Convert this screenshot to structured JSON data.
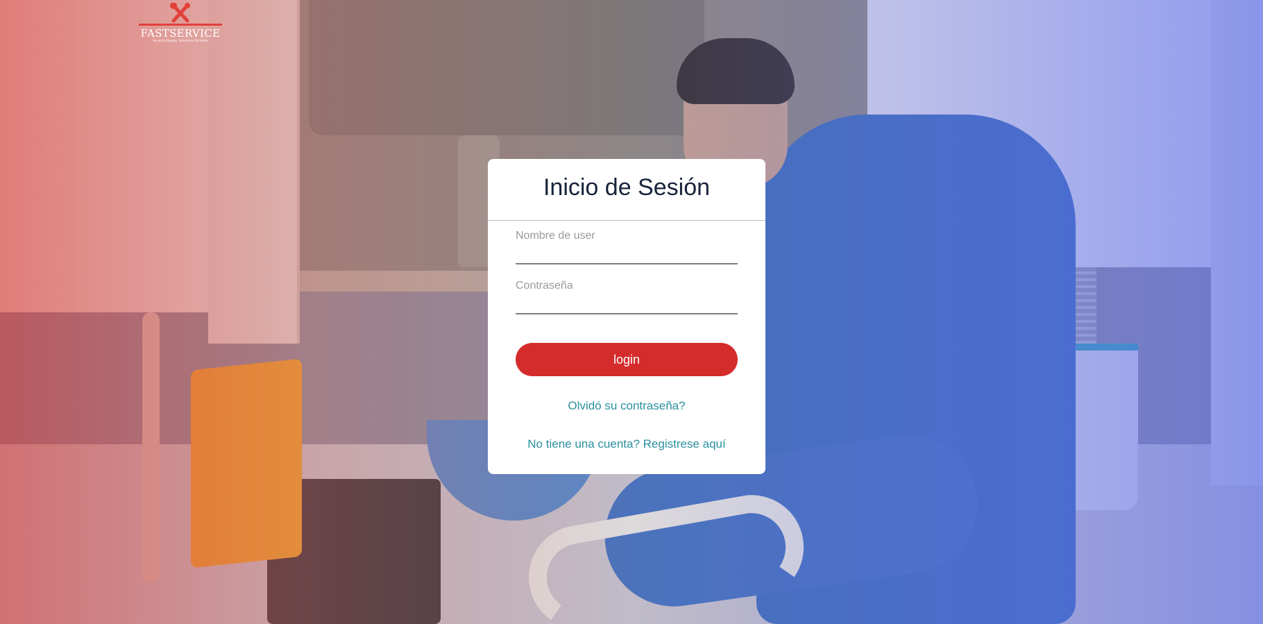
{
  "logo": {
    "name": "FASTSERVICE",
    "tagline": "Servicios Rápidos, Soluciones Eficientes",
    "icon": "wrench-screwdriver-icon",
    "color": "#e2403a"
  },
  "login": {
    "title": "Inicio de Sesión",
    "username_label": "Nombre de user",
    "username_value": "",
    "password_label": "Contraseña",
    "password_value": "",
    "submit_label": "login",
    "forgot_link": "Olvidó su contraseña?",
    "register_link": "No tiene una cuenta? Registrese aquí"
  },
  "colors": {
    "button": "#d42b2b",
    "link": "#2a8f9e",
    "title": "#16233a",
    "overlay_left": "#d63c3c",
    "overlay_right": "#5a6ef0"
  }
}
